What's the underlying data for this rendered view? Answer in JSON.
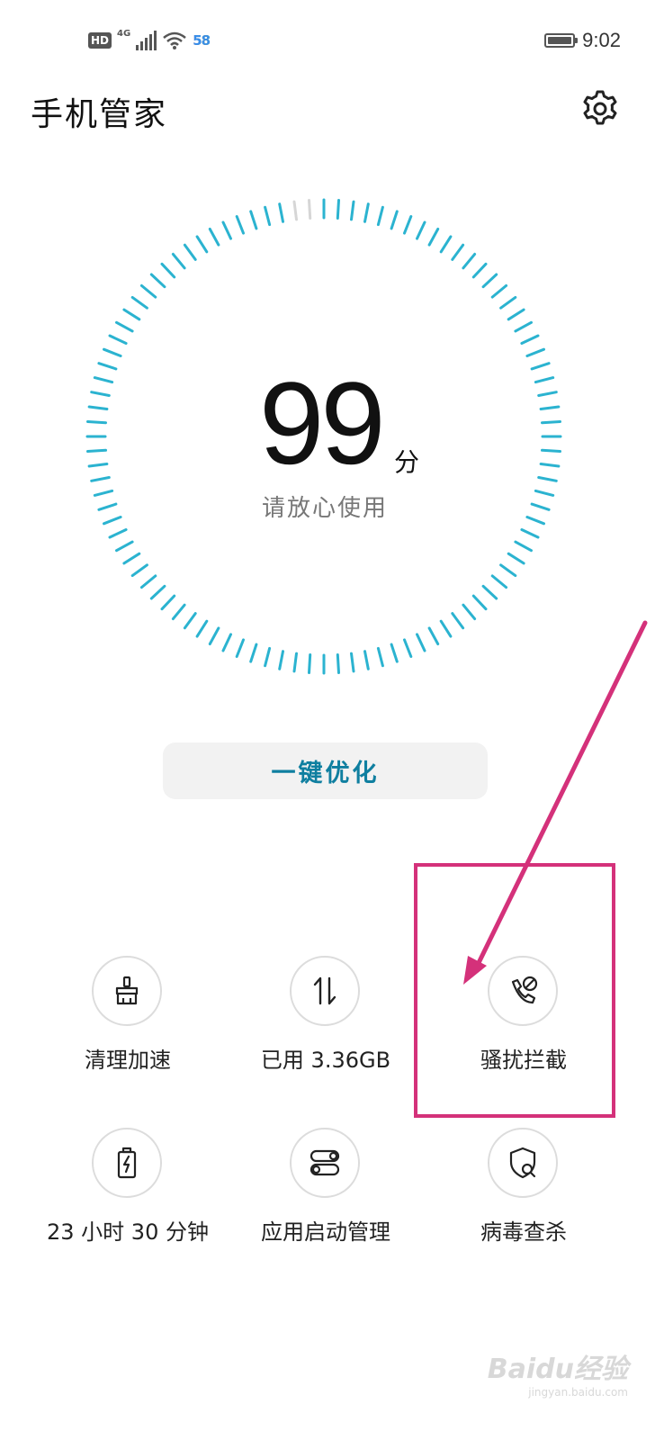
{
  "status_bar": {
    "hd": "HD",
    "network": "4G",
    "app_badge": "58",
    "time": "9:02"
  },
  "header": {
    "title": "手机管家",
    "settings_icon": "gear-icon"
  },
  "score": {
    "value": "99",
    "unit": "分",
    "subtitle": "请放心使用",
    "accent_color": "#2bb3d0"
  },
  "optimize_button": {
    "label": "一键优化",
    "color": "#0f7fa0"
  },
  "tools": [
    {
      "label": "清理加速",
      "icon": "broom-icon"
    },
    {
      "label": "已用 3.36GB",
      "icon": "data-arrows-icon"
    },
    {
      "label": "骚扰拦截",
      "icon": "phone-block-icon"
    },
    {
      "label": "23 小时 30 分钟",
      "icon": "battery-charge-icon"
    },
    {
      "label": "应用启动管理",
      "icon": "toggle-switches-icon"
    },
    {
      "label": "病毒查杀",
      "icon": "shield-search-icon"
    }
  ],
  "annotation": {
    "color": "#d4317a"
  },
  "watermark": {
    "text": "Baidu经验",
    "sub": "jingyan.baidu.com"
  }
}
